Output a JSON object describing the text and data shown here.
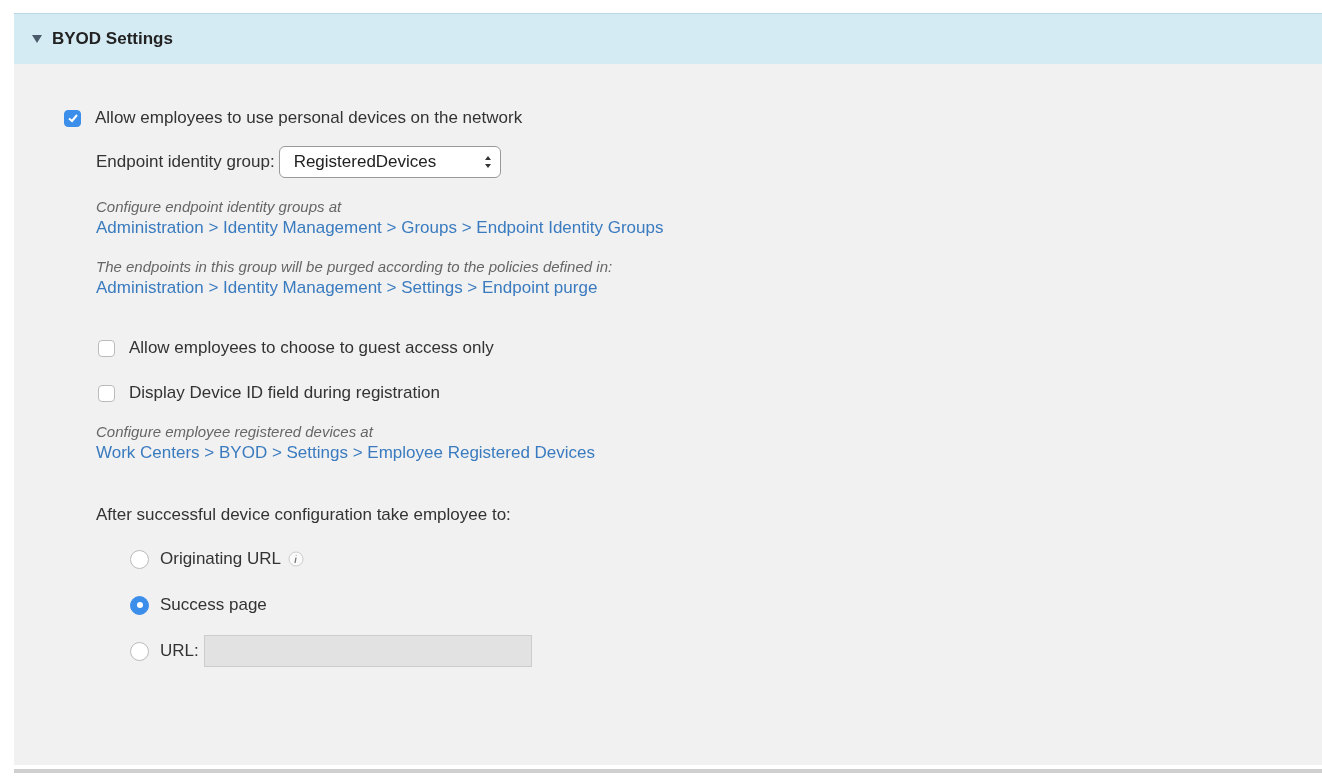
{
  "section": {
    "title": "BYOD Settings",
    "expanded": true
  },
  "allow_personal": {
    "label": "Allow employees to use personal devices on the network",
    "checked": true
  },
  "endpoint_group": {
    "label": "Endpoint identity group:",
    "value": "RegisteredDevices"
  },
  "notes_top": [
    {
      "text": "Configure endpoint identity groups at",
      "link": "Administration > Identity Management > Groups > Endpoint Identity Groups"
    },
    {
      "text": "The endpoints in this group will be purged according to the policies defined in:",
      "link": "Administration > Identity Management > Settings > Endpoint purge"
    }
  ],
  "options": [
    {
      "label": "Allow employees to choose to guest access only",
      "checked": false
    },
    {
      "label": "Display Device ID field during registration",
      "checked": false
    }
  ],
  "notes_bottom": [
    {
      "text": "Configure employee registered devices at",
      "link": "Work Centers > BYOD > Settings > Employee Registered Devices"
    }
  ],
  "redirect": {
    "heading": "After successful device configuration take employee to:",
    "choices": [
      {
        "kind": "info",
        "label": "Originating URL",
        "selected": false
      },
      {
        "kind": "plain",
        "label": "Success page",
        "selected": true
      },
      {
        "kind": "field",
        "label": "URL:",
        "selected": false,
        "disabled": true
      }
    ]
  }
}
